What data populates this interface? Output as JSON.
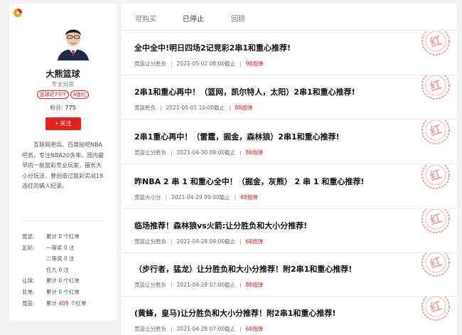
{
  "profile": {
    "name": "大熊篮球",
    "title": "专业玩家",
    "tags": [
      "篮球近7中7",
      "8连红"
    ],
    "fans_label": "粉丝:",
    "fans_count": "775",
    "follow_label": "+ 关注",
    "bio": "互联网老兵、百度贴吧NBA吧务，专注NBA20多年。国内最早的一批篮彩专业玩家，擅长大小分玩法，曾创造过篮彩实战18连红的辆人纪录。",
    "stats": [
      {
        "label": "竞足:",
        "value": "累计 0 个红单"
      },
      {
        "label": "足彩:",
        "value": "一等奖 0 注"
      },
      {
        "label": "",
        "value": "二等奖 0 注"
      },
      {
        "label": "",
        "value": "任九 0 注"
      },
      {
        "label": "让球:",
        "value": "累计 0 个红单"
      },
      {
        "label": "北单:",
        "value": "累计 0 个红单"
      },
      {
        "label": "竞篮:",
        "value_pre": "累计 ",
        "value_red": "409",
        "value_post": " 个红单"
      }
    ]
  },
  "tabs": [
    "可购买",
    "已停止",
    "回顾"
  ],
  "active_tab": "已停止",
  "stamp_text": "红",
  "items": [
    {
      "title": "全中全中!明日四场2记竞彩2串1和重心推荐!",
      "play": "竞篮让分胜负",
      "time": "2021-05-02 08:00截止",
      "price": "98炮弹"
    },
    {
      "title": "2串1和重心再中！（篮网，凯尔特人，太阳）2串1和重心推荐!",
      "play": "竞篮胜负",
      "time": "2021-05-01 10:00截止",
      "price": "88炮弹"
    },
    {
      "title": "2串1重心再中！（雷霆，掘金，森林狼）2串1和重心推荐!",
      "play": "竞篮让分胜负",
      "time": "2021-04-30 09:00截止",
      "price": "88炮弹"
    },
    {
      "title": "昨NBA 2 串 1 和重心全中！（掘金，灰熊） 2 串 1 和重心推荐!",
      "play": "竞篮大小分",
      "time": "2021-04-29 09:00截止",
      "price": "68炮弹"
    },
    {
      "title": "临场推荐！森林狼vs火箭:让分胜负和大小分推荐!",
      "play": "竞篮让分胜负",
      "time": "2021-04-28 09:00截止",
      "price": "68炮弹"
    },
    {
      "title": "（步行者，猛龙）让分胜负和大小分推荐！附2串1和重心推荐!",
      "play": "竞篮让分胜负",
      "time": "2021-04-28 07:00截止",
      "price": "88炮弹"
    },
    {
      "title": "(黄蜂，皇马)让分胜负和大小分推荐！附2串1和重心推荐!",
      "play": "竞篮让分胜负",
      "time": "2021-04-28 07:00截止",
      "price": "68炮弹"
    }
  ]
}
